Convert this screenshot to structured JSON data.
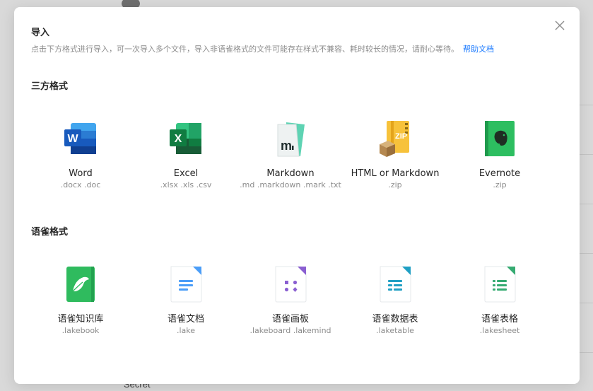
{
  "background": {
    "partial_text": "Secret"
  },
  "modal": {
    "title": "导入",
    "description": "点击下方格式进行导入，可一次导入多个文件，导入非语雀格式的文件可能存在样式不兼容、耗时较长的情况，请耐心等待。",
    "help_link": "帮助文档",
    "close_icon": "close-icon"
  },
  "third_party": {
    "title": "三方格式",
    "items": [
      {
        "name": "Word",
        "ext": ".docx .doc",
        "icon": "word-icon",
        "color": "#2b579a"
      },
      {
        "name": "Excel",
        "ext": ".xlsx .xls .csv",
        "icon": "excel-icon",
        "color": "#217346"
      },
      {
        "name": "Markdown",
        "ext": ".md .markdown .mark .txt",
        "icon": "markdown-icon",
        "color": "#5ed3b3"
      },
      {
        "name": "HTML or Markdown",
        "ext": ".zip",
        "icon": "zip-icon",
        "color": "#f7c23b"
      },
      {
        "name": "Evernote",
        "ext": ".zip",
        "icon": "evernote-icon",
        "color": "#2dbe60"
      }
    ]
  },
  "yuque": {
    "title": "语雀格式",
    "items": [
      {
        "name": "语雀知识库",
        "ext": ".lakebook",
        "icon": "lakebook-icon",
        "color": "#2fbb5e"
      },
      {
        "name": "语雀文档",
        "ext": ".lake",
        "icon": "lake-doc-icon",
        "color": "#4a9df8"
      },
      {
        "name": "语雀画板",
        "ext": ".lakeboard .lakemind",
        "icon": "lakeboard-icon",
        "color": "#8a5fd1"
      },
      {
        "name": "语雀数据表",
        "ext": ".laketable",
        "icon": "laketable-icon",
        "color": "#1f9fc4"
      },
      {
        "name": "语雀表格",
        "ext": ".lakesheet",
        "icon": "lakesheet-icon",
        "color": "#36ab72"
      }
    ]
  }
}
